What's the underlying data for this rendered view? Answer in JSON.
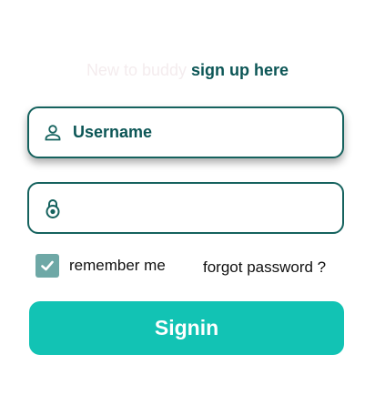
{
  "signup": {
    "prompt": "New to buddy",
    "link": "sign up here"
  },
  "username": {
    "placeholder": "Username",
    "value": "",
    "icon": "person-icon"
  },
  "password": {
    "placeholder": "",
    "value": "",
    "icon": "lock-icon"
  },
  "remember": {
    "label": "remember me",
    "checked": true
  },
  "forgot": {
    "label": "forgot password ?"
  },
  "signin": {
    "label": "Signin"
  },
  "colors": {
    "primary": "#12c3b4",
    "border": "#15625e",
    "text_dark": "#0c5656",
    "checkbox": "#6ea8a6"
  }
}
